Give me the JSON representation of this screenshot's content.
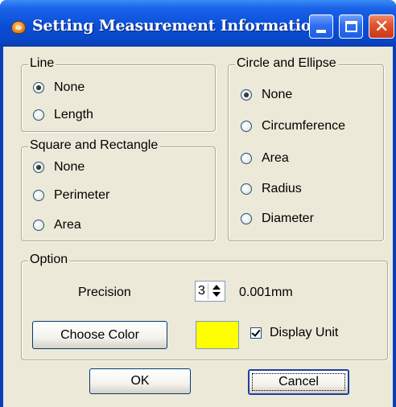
{
  "window": {
    "title": "Setting Measurement Information"
  },
  "line_group": {
    "legend": "Line",
    "options": [
      "None",
      "Length"
    ],
    "selected": "None"
  },
  "square_group": {
    "legend": "Square and Rectangle",
    "options": [
      "None",
      "Perimeter",
      "Area"
    ],
    "selected": "None"
  },
  "circle_group": {
    "legend": "Circle and Ellipse",
    "options": [
      "None",
      "Circumference",
      "Area",
      "Radius",
      "Diameter"
    ],
    "selected": "None"
  },
  "option_group": {
    "legend": "Option",
    "precision_label": "Precision",
    "precision_value": "3",
    "precision_unit": "0.001mm",
    "choose_color_label": "Choose Color",
    "color_value": "#ffff00",
    "display_unit_label": "Display Unit",
    "display_unit_checked": true
  },
  "buttons": {
    "ok": "OK",
    "cancel": "Cancel"
  },
  "icons": {
    "app": "app-icon",
    "minimize": "minimize-icon",
    "maximize": "maximize-icon",
    "close": "close-icon"
  }
}
